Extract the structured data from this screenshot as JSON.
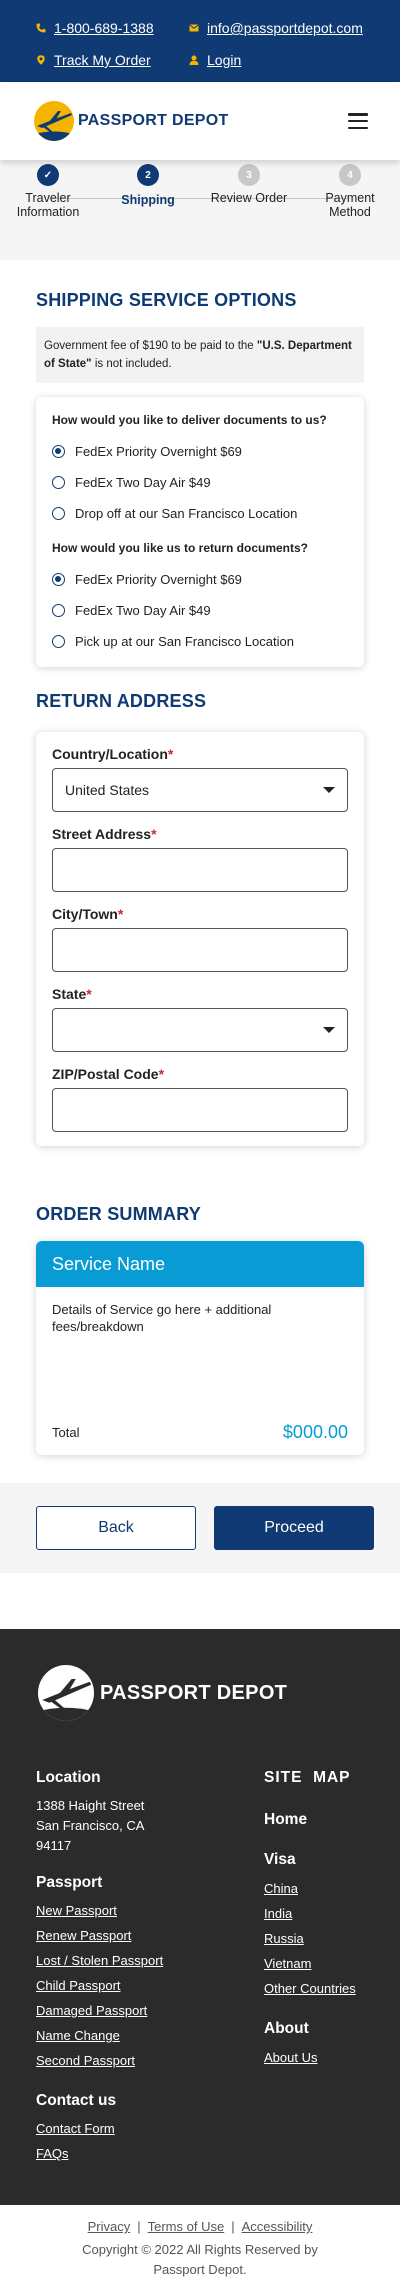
{
  "topbar": {
    "phone": "1-800-689-1388",
    "email": "info@passportdepot.com",
    "track": "Track My Order",
    "login": "Login"
  },
  "header": {
    "logo_text": "PASSPORT DEPOT",
    "menu_icon": "hamburger-icon"
  },
  "progress": {
    "steps": [
      {
        "number": "✓",
        "label": "Traveler Information",
        "state": "done"
      },
      {
        "number": "2",
        "label": "Shipping",
        "state": "active"
      },
      {
        "number": "3",
        "label": "Review Order",
        "state": "todo"
      },
      {
        "number": "4",
        "label": "Payment Method",
        "state": "todo"
      }
    ]
  },
  "shipping": {
    "title": "SHIPPING SERVICE OPTIONS",
    "notice_pre": "Government fee of $190 to be paid to the ",
    "notice_bold": "\"U.S. Department of State\"",
    "notice_post": " is not included.",
    "deliver_question": "How would you like to deliver documents to us?",
    "deliver_options": [
      "FedEx Priority Overnight $69",
      "FedEx Two Day Air $49",
      "Drop off at our San Francisco Location"
    ],
    "deliver_selected": 0,
    "return_question": "How would you like us to return documents?",
    "return_options": [
      "FedEx Priority Overnight $69",
      "FedEx Two Day Air $49",
      "Pick up at our San Francisco Location"
    ],
    "return_selected": 0
  },
  "address": {
    "title": "RETURN ADDRESS",
    "country_label": "Country/Location",
    "country_value": "United States",
    "street_label": "Street Address",
    "city_label": "City/Town",
    "state_label": "State",
    "zip_label": "ZIP/Postal Code",
    "required_mark": "*"
  },
  "summary": {
    "title": "ORDER SUMMARY",
    "service_name": "Service Name",
    "details": "Details of Service go here + additional fees/breakdown",
    "total_label": "Total",
    "total_value": "$000.00"
  },
  "actions": {
    "back": "Back",
    "proceed": "Proceed"
  },
  "footer": {
    "logo_text": "PASSPORT DEPOT",
    "location_title": "Location",
    "address_lines": [
      "1388 Haight Street",
      "San Francisco, CA",
      "94117"
    ],
    "passport_title": "Passport",
    "passport_links": [
      "New Passport",
      "Renew Passport",
      "Lost / Stolen Passport",
      "Child Passport",
      "Damaged Passport",
      "Name Change",
      "Second Passport"
    ],
    "contact_title": "Contact us",
    "contact_links": [
      "Contact Form",
      "FAQs"
    ],
    "sitemap_title": "SITE  MAP",
    "home": "Home",
    "visa_title": "Visa",
    "visa_links": [
      "China",
      "India",
      "Russia",
      "Vietnam",
      "Other Countries"
    ],
    "about_title": "About",
    "about_links": [
      "About Us"
    ]
  },
  "bottom": {
    "privacy": "Privacy",
    "terms": "Terms of Use",
    "accessibility": "Accessibility",
    "separator": "|",
    "copyright": "Copyright © 2022 All Rights Reserved by Passport Depot."
  },
  "colors": {
    "brand_navy": "#0f3a73",
    "accent_blue": "#099cd4",
    "logo_yellow": "#f5b400",
    "footer_bg": "#2b2b2b"
  }
}
